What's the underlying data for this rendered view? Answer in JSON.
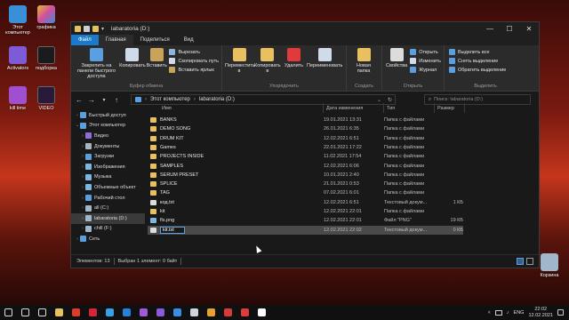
{
  "desktop": {
    "icons": [
      {
        "label": "Этот компьютер",
        "icon": "computer-icon",
        "color": "#3a8fd9"
      },
      {
        "label": "графика",
        "icon": "app-icon",
        "color": "#e8b730"
      },
      {
        "label": "Activators",
        "icon": "folder-icon",
        "color": "#7d5bd6"
      },
      {
        "label": "подборка",
        "icon": "folder-icon",
        "color": "#e8c060"
      },
      {
        "label": "kill time",
        "icon": "app-icon",
        "color": "#a04fd0"
      },
      {
        "label": "VIDEO",
        "icon": "folder-icon",
        "color": "#e8c060"
      },
      {
        "label": "Корзина",
        "icon": "recycle-bin-icon",
        "color": "#9fb7c9"
      }
    ]
  },
  "window": {
    "title": "labaratoria (D:)",
    "controls": {
      "minimize": "—",
      "maximize": "☐",
      "close": "✕"
    },
    "tabs": {
      "file": "Файл",
      "home": "Главная",
      "share": "Поделиться",
      "view": "Вид"
    }
  },
  "ribbon": {
    "clipboard": {
      "caption": "Буфер обмена",
      "pin": "Закрепить на панели быстрого доступа",
      "copy": "Копировать",
      "paste": "Вставить",
      "cut": "Вырезать",
      "copy_path": "Скопировать путь",
      "paste_shortcut": "Вставить ярлык"
    },
    "organize": {
      "caption": "Упорядочить",
      "move_to": "Переместить в",
      "copy_to": "Копировать в",
      "delete": "Удалить",
      "rename": "Переименовать"
    },
    "new": {
      "caption": "Создать",
      "new_folder": "Новая папка"
    },
    "open": {
      "caption": "Открыть",
      "properties": "Свойства",
      "open": "Открыть",
      "edit": "Изменить",
      "history": "Журнал"
    },
    "select": {
      "caption": "Выделить",
      "select_all": "Выделить все",
      "select_none": "Снять выделение",
      "invert": "Обратить выделение"
    }
  },
  "address": {
    "breadcrumb": [
      "Этот компьютер",
      "labaratoria (D:)"
    ],
    "search_placeholder": "Поиск: labaratoria (D:)"
  },
  "navigation": [
    {
      "label": "Быстрый доступ",
      "icon": "star-icon",
      "color": "#5aa0e0",
      "level": 0,
      "expander": ">",
      "selected": false
    },
    {
      "label": "Этот компьютер",
      "icon": "computer-icon",
      "color": "#5aa0e0",
      "level": 0,
      "expander": "v",
      "selected": false
    },
    {
      "label": "Видео",
      "icon": "video-icon",
      "color": "#8a6fd8",
      "level": 1,
      "expander": ">",
      "selected": false
    },
    {
      "label": "Документы",
      "icon": "documents-icon",
      "color": "#aab4c0",
      "level": 1,
      "expander": ">",
      "selected": false
    },
    {
      "label": "Загрузки",
      "icon": "download-icon",
      "color": "#5aa0e0",
      "level": 1,
      "expander": ">",
      "selected": false
    },
    {
      "label": "Изображения",
      "icon": "pictures-icon",
      "color": "#7cb7e0",
      "level": 1,
      "expander": ">",
      "selected": false
    },
    {
      "label": "Музыка",
      "icon": "music-icon",
      "color": "#7cb7e0",
      "level": 1,
      "expander": ">",
      "selected": false
    },
    {
      "label": "Объемные объект",
      "icon": "3d-objects-icon",
      "color": "#7cb7e0",
      "level": 1,
      "expander": ">",
      "selected": false
    },
    {
      "label": "Рабочий стол",
      "icon": "desktop-icon",
      "color": "#5aa0e0",
      "level": 1,
      "expander": ">",
      "selected": false
    },
    {
      "label": "all (C:)",
      "icon": "drive-icon",
      "color": "#9fb7c9",
      "level": 1,
      "expander": ">",
      "selected": false
    },
    {
      "label": "labaratoria (D:)",
      "icon": "drive-icon",
      "color": "#9fb7c9",
      "level": 1,
      "expander": ">",
      "selected": true
    },
    {
      "label": "chill (F:)",
      "icon": "drive-icon",
      "color": "#9fb7c9",
      "level": 1,
      "expander": ">",
      "selected": false
    },
    {
      "label": "Сеть",
      "icon": "network-icon",
      "color": "#5aa0e0",
      "level": 0,
      "expander": ">",
      "selected": false
    }
  ],
  "columns": {
    "name": "Имя",
    "modified": "Дата изменения",
    "type": "Тип",
    "size": "Размер"
  },
  "files": [
    {
      "name": "BANKS",
      "modified": "19.01.2021 13:31",
      "type": "Папка с файлами",
      "size": "",
      "icon": "folder-icon",
      "color": "#e8c060",
      "selected": false
    },
    {
      "name": "DEMO SONG",
      "modified": "26.01.2021 6:35",
      "type": "Папка с файлами",
      "size": "",
      "icon": "folder-icon",
      "color": "#e8c060",
      "selected": false
    },
    {
      "name": "DRUM KIT",
      "modified": "12.02.2021 6:51",
      "type": "Папка с файлами",
      "size": "",
      "icon": "folder-icon",
      "color": "#e8c060",
      "selected": false
    },
    {
      "name": "Games",
      "modified": "22.01.2021 17:22",
      "type": "Папка с файлами",
      "size": "",
      "icon": "folder-icon",
      "color": "#e8c060",
      "selected": false
    },
    {
      "name": "PROJECTS INSIDE",
      "modified": "11.02.2021 17:54",
      "type": "Папка с файлами",
      "size": "",
      "icon": "folder-icon",
      "color": "#e8c060",
      "selected": false
    },
    {
      "name": "SAMPLES",
      "modified": "12.02.2021 6:06",
      "type": "Папка с файлами",
      "size": "",
      "icon": "folder-icon",
      "color": "#e8c060",
      "selected": false
    },
    {
      "name": "SERUM PRESET",
      "modified": "10.01.2021 2:40",
      "type": "Папка с файлами",
      "size": "",
      "icon": "folder-icon",
      "color": "#e8c060",
      "selected": false
    },
    {
      "name": "SPLICE",
      "modified": "21.01.2021 0:53",
      "type": "Папка с файлами",
      "size": "",
      "icon": "folder-icon",
      "color": "#e8c060",
      "selected": false
    },
    {
      "name": "TAG",
      "modified": "07.02.2021 6:01",
      "type": "Папка с файлами",
      "size": "",
      "icon": "folder-icon",
      "color": "#e8c060",
      "selected": false
    },
    {
      "name": "код.txt",
      "modified": "12.02.2021 6:51",
      "type": "Текстовый докум...",
      "size": "1 КБ",
      "icon": "text-file-icon",
      "color": "#dcdcdc",
      "selected": false
    },
    {
      "name": "kit",
      "modified": "12.02.2021 22:01",
      "type": "Папка с файлами",
      "size": "",
      "icon": "folder-icon",
      "color": "#e8c060",
      "selected": false
    },
    {
      "name": "fls.png",
      "modified": "12.02.2021 22:01",
      "type": "Файл \"PNG\"",
      "size": "19 КБ",
      "icon": "image-file-icon",
      "color": "#7cb7e0",
      "selected": false
    },
    {
      "name": "kit.txt",
      "modified": "12.02.2021 22:02",
      "type": "Текстовый докум...",
      "size": "0 КБ",
      "icon": "text-file-icon",
      "color": "#dcdcdc",
      "selected": true,
      "renaming": true
    }
  ],
  "status": {
    "items": "Элементов: 13",
    "selected": "Выбран 1 элемент: 0 байт"
  },
  "taskbar": {
    "apps": [
      {
        "icon": "start-icon",
        "color": "#dcdcdc"
      },
      {
        "icon": "search-icon",
        "color": "#dcdcdc"
      },
      {
        "icon": "task-view-icon",
        "color": "#dcdcdc"
      },
      {
        "icon": "explorer-icon",
        "color": "#e8c060"
      },
      {
        "icon": "yandex-browser-icon",
        "color": "#e03a2a"
      },
      {
        "icon": "opera-icon",
        "color": "#d8243a"
      },
      {
        "icon": "telegram-icon",
        "color": "#3aa0e0"
      },
      {
        "icon": "app-icon",
        "color": "#2a7fd8"
      },
      {
        "icon": "app-icon",
        "color": "#a05ad8"
      },
      {
        "icon": "premiere-icon",
        "color": "#8a5ad8"
      },
      {
        "icon": "photoshop-icon",
        "color": "#3a8fe0"
      },
      {
        "icon": "steam-icon",
        "color": "#cfd6de"
      },
      {
        "icon": "shield-icon",
        "color": "#e8a030"
      },
      {
        "icon": "app-icon",
        "color": "#d83a3a"
      },
      {
        "icon": "record-icon",
        "color": "#e03a3a"
      },
      {
        "icon": "app-icon",
        "color": "#ffffff"
      }
    ],
    "tray": {
      "lang": "ENG",
      "time": "22:02",
      "date": "12.02.2021"
    }
  }
}
